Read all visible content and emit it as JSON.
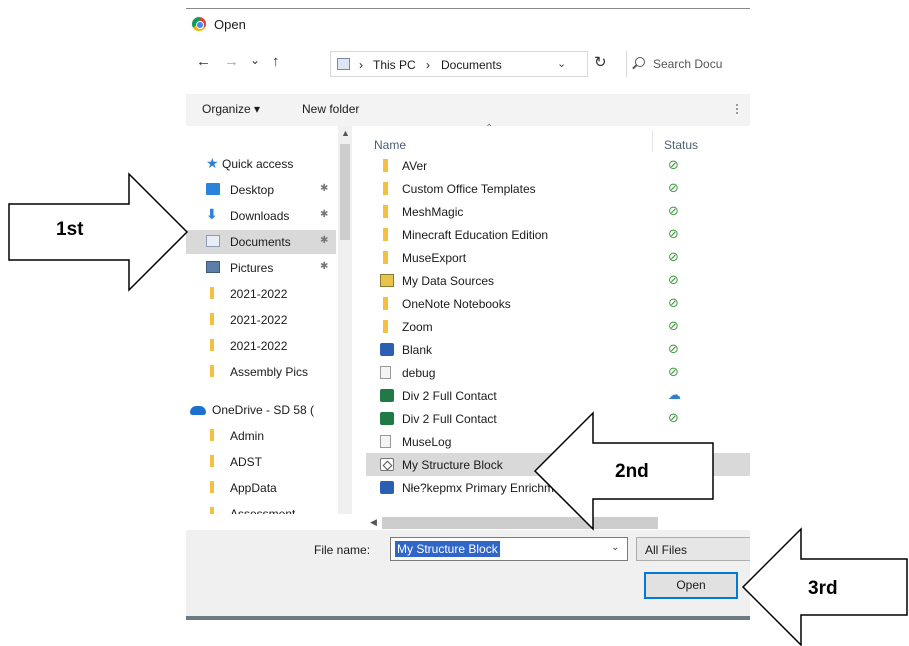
{
  "window": {
    "title": "Open"
  },
  "navigation": {
    "back": "←",
    "forward": "→",
    "recent": "⌄",
    "up": "↑",
    "breadcrumb": [
      "This PC",
      "Documents"
    ],
    "separator": "›",
    "refresh": "↻",
    "search_placeholder": "Search Docu"
  },
  "toolbar": {
    "organize": "Organize ▾",
    "new_folder": "New folder"
  },
  "sidebar": {
    "items": [
      {
        "label": "Quick access",
        "icon": "star-icon",
        "pinned": false
      },
      {
        "label": "Desktop",
        "icon": "desktop-icon",
        "pinned": true
      },
      {
        "label": "Downloads",
        "icon": "download-icon",
        "pinned": true
      },
      {
        "label": "Documents",
        "icon": "documents-icon",
        "pinned": true,
        "selected": true
      },
      {
        "label": "Pictures",
        "icon": "pictures-icon",
        "pinned": true
      },
      {
        "label": "2021-2022",
        "icon": "folder-icon",
        "pinned": false
      },
      {
        "label": "2021-2022",
        "icon": "folder-icon",
        "pinned": false
      },
      {
        "label": "2021-2022",
        "icon": "folder-icon",
        "pinned": false
      },
      {
        "label": "Assembly Pics",
        "icon": "folder-icon",
        "pinned": false
      },
      {
        "label": "OneDrive - SD 58 (",
        "icon": "onedrive-icon",
        "pinned": false
      },
      {
        "label": "Admin",
        "icon": "folder-icon",
        "pinned": false
      },
      {
        "label": "ADST",
        "icon": "folder-icon",
        "pinned": false
      },
      {
        "label": "AppData",
        "icon": "folder-icon",
        "pinned": false
      },
      {
        "label": "Assessment",
        "icon": "folder-icon",
        "pinned": false
      }
    ],
    "pin_glyph": "📌"
  },
  "file_list": {
    "columns": {
      "name": "Name",
      "status": "Status"
    },
    "rows": [
      {
        "name": "AVer",
        "type": "folder",
        "status": "synced"
      },
      {
        "name": "Custom Office Templates",
        "type": "folder",
        "status": "synced"
      },
      {
        "name": "MeshMagic",
        "type": "folder",
        "status": "synced"
      },
      {
        "name": "Minecraft Education Edition",
        "type": "folder",
        "status": "synced"
      },
      {
        "name": "MuseExport",
        "type": "folder",
        "status": "synced"
      },
      {
        "name": "My Data Sources",
        "type": "special",
        "status": "synced"
      },
      {
        "name": "OneNote Notebooks",
        "type": "folder",
        "status": "synced"
      },
      {
        "name": "Zoom",
        "type": "folder",
        "status": "synced"
      },
      {
        "name": "Blank",
        "type": "word",
        "status": "synced"
      },
      {
        "name": "debug",
        "type": "txt",
        "status": "synced"
      },
      {
        "name": "Div 2 Full Contact",
        "type": "excel",
        "status": "cloud"
      },
      {
        "name": "Div 2 Full Contact",
        "type": "excel",
        "status": "synced"
      },
      {
        "name": "MuseLog",
        "type": "txt",
        "status": ""
      },
      {
        "name": "My Structure Block",
        "type": "block",
        "status": "",
        "selected": true
      },
      {
        "name": "Nłe?kepmx Primary Enrichm",
        "type": "word",
        "status": ""
      }
    ],
    "status_glyphs": {
      "synced": "⊘",
      "cloud": "☁"
    }
  },
  "footer": {
    "file_name_label": "File name:",
    "file_name_value": "My Structure Block",
    "file_type": "All Files",
    "open_button": "Open"
  },
  "annotations": {
    "first": "1st",
    "second": "2nd",
    "third": "3rd"
  }
}
